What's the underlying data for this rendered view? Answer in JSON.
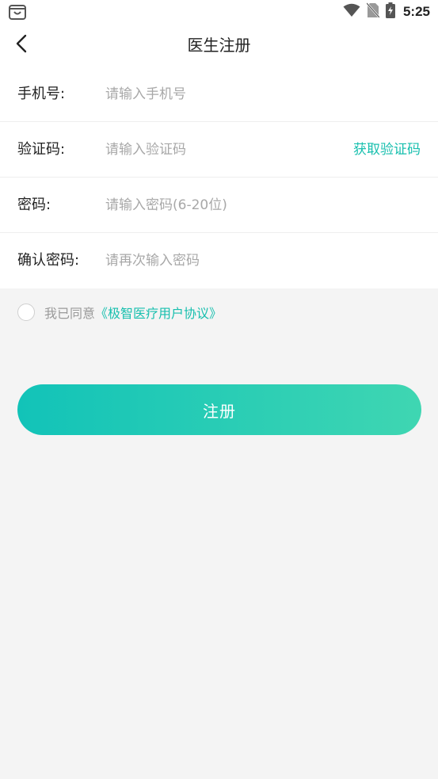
{
  "status_bar": {
    "time": "5:25",
    "icons": [
      "app-notification-icon",
      "wifi-icon",
      "no-sim-icon",
      "battery-charging-icon"
    ]
  },
  "nav": {
    "title": "医生注册",
    "back_icon": "chevron-left-icon"
  },
  "form": {
    "phone": {
      "label": "手机号:",
      "placeholder": "请输入手机号",
      "value": ""
    },
    "code": {
      "label": "验证码:",
      "placeholder": "请输入验证码",
      "value": "",
      "action": "获取验证码"
    },
    "password": {
      "label": "密码:",
      "placeholder": "请输入密码(6-20位)",
      "value": ""
    },
    "confirm": {
      "label": "确认密码:",
      "placeholder": "请再次输入密码",
      "value": ""
    }
  },
  "agreement": {
    "prefix": "我已同意",
    "link": "《极智医疗用户协议》",
    "checked": false
  },
  "register_button": {
    "label": "注册"
  },
  "colors": {
    "accent": "#17bfae",
    "gradient_start": "#12c3b8",
    "gradient_end": "#3fd6b2",
    "background": "#f4f4f4"
  }
}
